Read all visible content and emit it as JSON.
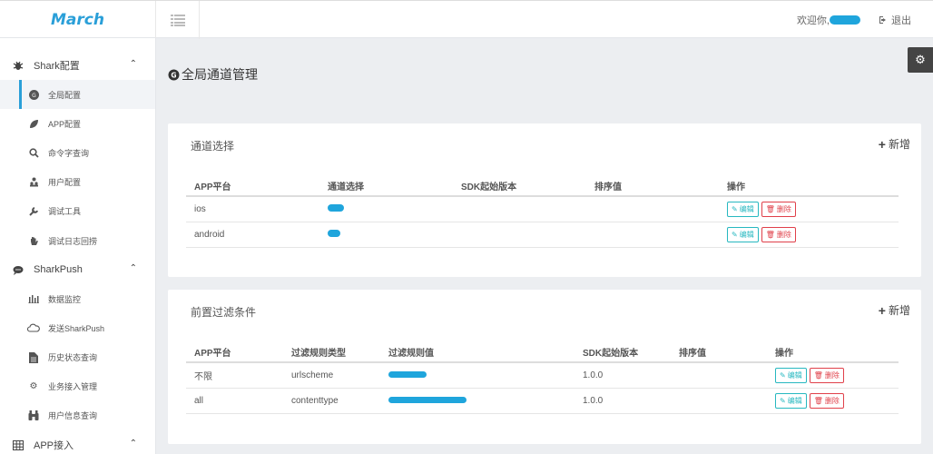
{
  "header": {
    "logo": "March",
    "welcome": "欢迎你,",
    "logout": "退出"
  },
  "sidebar": {
    "groups": [
      {
        "label": "Shark配置",
        "icon": "bug-icon",
        "items": [
          {
            "label": "全局配置",
            "icon": "google-plus-icon",
            "active": true
          },
          {
            "label": "APP配置",
            "icon": "leaf-icon"
          },
          {
            "label": "命令字查询",
            "icon": "search-icon"
          },
          {
            "label": "用户配置",
            "icon": "users-icon"
          },
          {
            "label": "调试工具",
            "icon": "wrench-icon"
          },
          {
            "label": "调试日志回捞",
            "icon": "hand-icon"
          }
        ]
      },
      {
        "label": "SharkPush",
        "icon": "comment-icon",
        "items": [
          {
            "label": "数据监控",
            "icon": "bar-chart-icon"
          },
          {
            "label": "发送SharkPush",
            "icon": "cloud-icon"
          },
          {
            "label": "历史状态查询",
            "icon": "file-icon"
          },
          {
            "label": "业务接入管理",
            "icon": "gear-icon"
          },
          {
            "label": "用户信息查询",
            "icon": "binoculars-icon"
          }
        ]
      },
      {
        "label": "APP接入",
        "icon": "table-icon",
        "items": []
      }
    ]
  },
  "page": {
    "title": "全局通道管理"
  },
  "channel_panel": {
    "title": "通道选择",
    "add_label": "新增",
    "columns": [
      "APP平台",
      "通道选择",
      "SDK起始版本",
      "排序值",
      "操作"
    ],
    "rows": [
      {
        "platform": "ios",
        "channel": "",
        "sdk": "",
        "order": ""
      },
      {
        "platform": "android",
        "channel": "",
        "sdk": "",
        "order": ""
      }
    ],
    "edit_label": "编辑",
    "delete_label": "删除"
  },
  "filter_panel": {
    "title": "前置过滤条件",
    "add_label": "新增",
    "columns": [
      "APP平台",
      "过滤规则类型",
      "过滤规则值",
      "SDK起始版本",
      "排序值",
      "操作"
    ],
    "rows": [
      {
        "platform": "不限",
        "type": "urlscheme",
        "value": "",
        "sdk": "1.0.0",
        "order": ""
      },
      {
        "platform": "all",
        "type": "contenttype",
        "value": "",
        "sdk": "1.0.0",
        "order": ""
      }
    ],
    "edit_label": "编辑",
    "delete_label": "删除"
  },
  "colors": {
    "accent": "#2a9fd8",
    "redaction": "#1fa5dc",
    "edit": "#27b8c0",
    "delete": "#e0404a"
  }
}
